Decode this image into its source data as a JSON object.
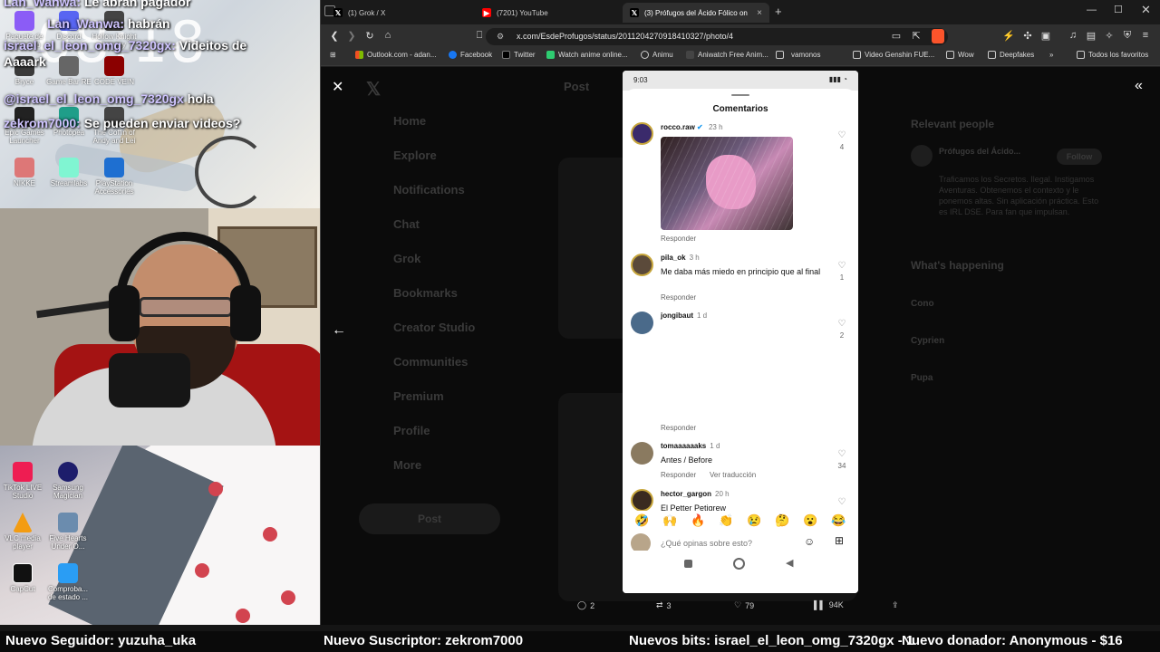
{
  "overlay": {
    "clock": "08:18",
    "chat": [
      {
        "user": "Lan_Wanwa:",
        "text": "Le abran pagador"
      },
      {
        "user": "Lan_Wanwa:",
        "text": "habrán"
      },
      {
        "user": "israel_el_leon_omg_7320gx:",
        "text": "Videitos de"
      },
      {
        "user": "",
        "text": "Aaaark"
      },
      {
        "user": "@israel_el_leon_omg_7320gx",
        "text": "hola"
      },
      {
        "user": "zekrom7000:",
        "text": "Se pueden enviar videos?"
      }
    ],
    "desktop_icons": [
      {
        "label": "Paquete de recreativo",
        "color": "#8b5cf6"
      },
      {
        "label": "Discord",
        "color": "#5865f2"
      },
      {
        "label": "Hollow Knight Legacy",
        "color": "#444"
      },
      {
        "label": "Bryce",
        "color": "#3a3a3a"
      },
      {
        "label": "Game Bar RE",
        "color": "#666"
      },
      {
        "label": "CODE VEIN",
        "color": "#8b0000"
      },
      {
        "label": "Epic Games Launcher",
        "color": "#222"
      },
      {
        "label": "Photopea",
        "color": "#1f9e89"
      },
      {
        "label": "The Coffin of Andy and Lei",
        "color": "#444"
      },
      {
        "label": "NIKKE",
        "color": "#d77"
      },
      {
        "label": "Streamlabs",
        "color": "#80f5d2"
      },
      {
        "label": "PlayStation Accessories",
        "color": "#1e6fd1"
      },
      {
        "label": "TikTok LIVE Studio",
        "color": "#ee1d52"
      },
      {
        "label": "Samsung Magician",
        "color": "#1d1d6b"
      },
      {
        "label": "VLC media player",
        "color": "#f39c12"
      },
      {
        "label": "Five Hearts Under O...",
        "color": "#6b8cae"
      },
      {
        "label": "CapCut",
        "color": "#111"
      },
      {
        "label": "Comproba... de estado ...",
        "color": "#2a9df4"
      }
    ],
    "ticker": {
      "follower": "Nuevo Seguidor: yuzuha_uka",
      "subscriber": "Nuevo Suscriptor: zekrom7000",
      "bits": "Nuevos bits: israel_el_leon_omg_7320gx - 1",
      "donor": "Nuevo donador: Anonymous - $16"
    }
  },
  "browser": {
    "tabs": [
      {
        "title": "(1) Grok / X",
        "icon": "x-icon",
        "active": false
      },
      {
        "title": "(7201) YouTube",
        "icon": "youtube-icon",
        "active": false
      },
      {
        "title": "(3) Prófugos del Ácido Fólico on",
        "icon": "x-icon",
        "active": true
      }
    ],
    "url": "x.com/EsdeProfugos/status/2011204270918410327/photo/4",
    "bookmarks": [
      "Outlook.com - adan...",
      "Facebook",
      "Twitter",
      "Watch anime online...",
      "Animu",
      "Aniwatch Free Anim...",
      "vamonos",
      "Video Genshin FUE...",
      "Wow",
      "Deepfakes"
    ],
    "bookmarks_right": "Todos los favoritos",
    "accent": "#1d9bf0"
  },
  "x_page": {
    "nav": [
      "Home",
      "Explore",
      "Notifications",
      "Chat",
      "Grok",
      "Bookmarks",
      "Creator Studio",
      "Communities",
      "Premium",
      "Profile",
      "More"
    ],
    "post_button": "Post",
    "header": "Post",
    "right_title": "Relevant people",
    "right_name": "Prófugos del Ácido...",
    "right_follow": "Follow",
    "right_bio": "Traficamos los Secretos. Ilegal. Instigamos Aventuras. Obtenemos el contexto y le ponemos altas. Sin aplicación práctica. Esto es IRL DSE. Para fan que impulsan.",
    "happening": "What's happening",
    "trends": [
      "Cono",
      "Cyprien",
      "Pupa"
    ],
    "actions": {
      "replies": "2",
      "reposts": "3",
      "likes": "79",
      "views": "94K"
    }
  },
  "phone": {
    "status_time": "9:03",
    "sheet_title": "Comentarios",
    "comments": [
      {
        "user": "rocco.raw",
        "verified": true,
        "time": "23 h",
        "text": "",
        "has_image": true,
        "reply": "Responder",
        "likes": "4",
        "avatar": "#3a2a6b"
      },
      {
        "user": "pila_ok",
        "time": "3 h",
        "text": "Me daba más miedo en principio que al final",
        "reply": "Responder",
        "likes": "1",
        "avatar": "#5b4a3a"
      },
      {
        "user": "jongibaut",
        "time": "1 d",
        "text": "",
        "reply": "Responder",
        "likes": "2",
        "avatar": "#4a6a8a"
      },
      {
        "user": "tomaaaaaaks",
        "time": "1 d",
        "text": "Antes / Before",
        "reply": "Responder",
        "translate": "Ver traducción",
        "likes": "34",
        "avatar": "#8a7a60"
      },
      {
        "user": "hector_gargon",
        "time": "20 h",
        "text": "El Petter Petigrew",
        "reply": "",
        "likes": "1",
        "avatar": "#3a2a20"
      }
    ],
    "emojis": [
      "🤣",
      "🙌",
      "🔥",
      "👏",
      "😢",
      "🤔",
      "😮",
      "😂"
    ],
    "input_placeholder": "¿Qué opinas sobre esto?"
  }
}
